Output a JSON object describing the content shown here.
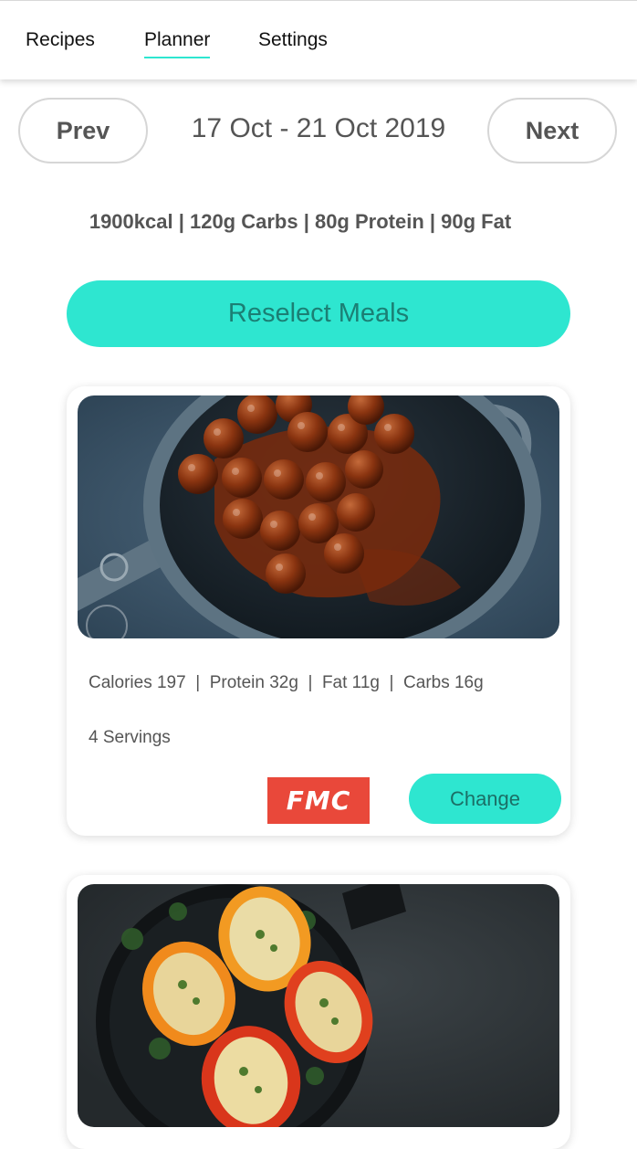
{
  "nav": {
    "tabs": [
      {
        "label": "Recipes",
        "active": false
      },
      {
        "label": "Planner",
        "active": true
      },
      {
        "label": "Settings",
        "active": false
      }
    ]
  },
  "week": {
    "prev_label": "Prev",
    "next_label": "Next",
    "date_range": "17 Oct -  21 Oct 2019"
  },
  "targets": {
    "summary": "1900kcal | 120g Carbs | 80g Protein | 90g Fat"
  },
  "reselect_label": "Reselect Meals",
  "meals": [
    {
      "image": "meatballs-in-pan",
      "nutrition": "Calories 197  |  Protein 32g  |  Fat 11g  |  Carbs 16g",
      "servings": "4 Servings",
      "brand": "FMC",
      "change_label": "Change"
    },
    {
      "image": "stuffed-peppers-in-skillet"
    }
  ],
  "colors": {
    "accent": "#2ee6d0",
    "accent_text": "#1b7f74",
    "brand_red": "#e9483a"
  }
}
